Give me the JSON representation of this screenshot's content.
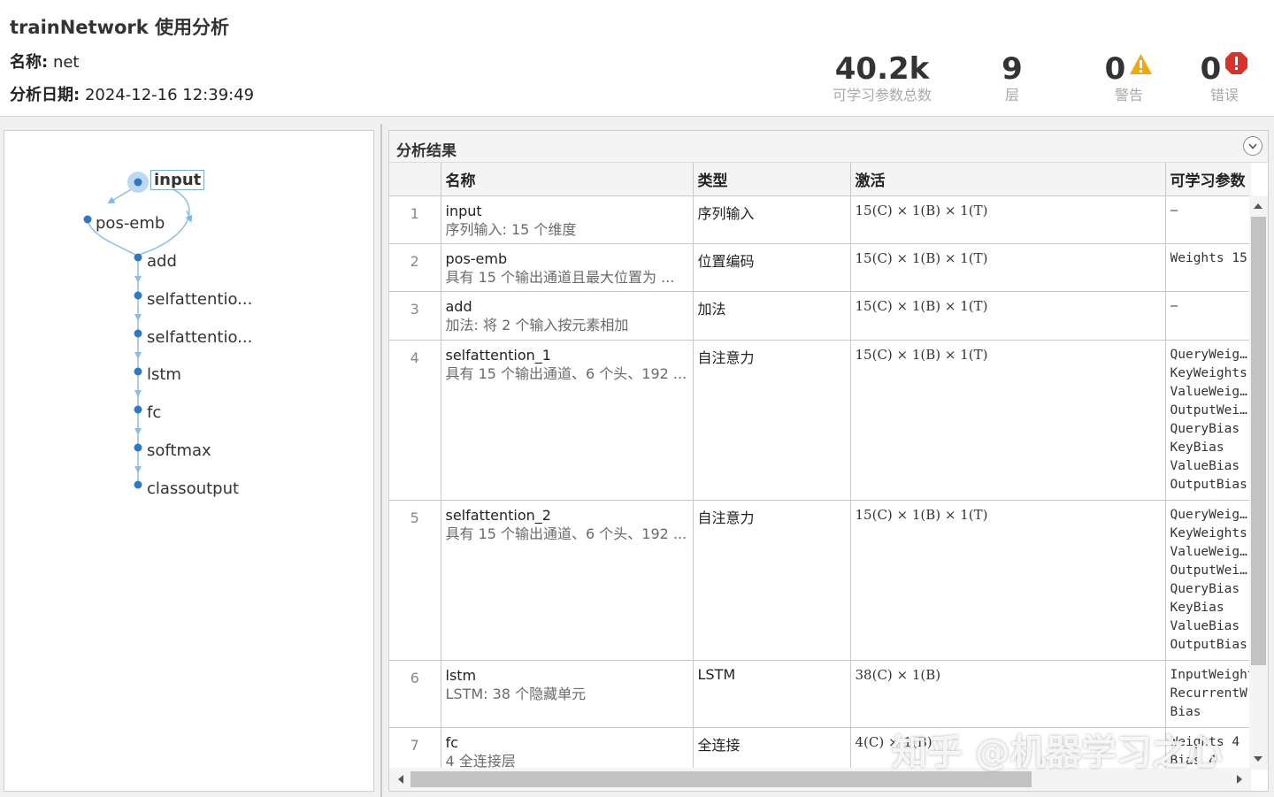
{
  "header": {
    "title": "trainNetwork 使用分析",
    "name_label": "名称:",
    "name_value": "net",
    "date_label": "分析日期:",
    "date_value": "2024-12-16 12:39:49"
  },
  "stats": {
    "params": {
      "value": "40.2k",
      "label": "可学习参数总数"
    },
    "layers": {
      "value": "9",
      "label": "层"
    },
    "warnings": {
      "value": "0",
      "label": "警告",
      "icon": "warning-icon",
      "color": "#f2a80c"
    },
    "errors": {
      "value": "0",
      "label": "错误",
      "icon": "error-icon",
      "color": "#d9322b"
    }
  },
  "graph": {
    "accent": "#2f78c4",
    "edge_color": "#8cbde6",
    "nodes": [
      "input",
      "pos-emb",
      "add",
      "selfattentio...",
      "selfattentio...",
      "lstm",
      "fc",
      "softmax",
      "classoutput"
    ],
    "selected": "input"
  },
  "results": {
    "title": "分析结果",
    "columns": [
      "名称",
      "类型",
      "激活",
      "可学习参数"
    ],
    "rows": [
      {
        "index": "1",
        "name": "input",
        "desc": "序列输入: 15 个维度",
        "type": "序列输入",
        "activation": "15(C) × 1(B) × 1(T)",
        "params": [
          "–"
        ]
      },
      {
        "index": "2",
        "name": "pos-emb",
        "desc": "具有 15 个输出通道且最大位置为 ...",
        "type": "位置编码",
        "activation": "15(C) × 1(B) × 1(T)",
        "params": [
          "Weights  15"
        ]
      },
      {
        "index": "3",
        "name": "add",
        "desc": "加法: 将 2 个输入按元素相加",
        "type": "加法",
        "activation": "15(C) × 1(B) × 1(T)",
        "params": [
          "–"
        ]
      },
      {
        "index": "4",
        "name": "selfattention_1",
        "desc": "具有 15 个输出通道、6 个头、192 ...",
        "type": "自注意力",
        "activation": "15(C) × 1(B) × 1(T)",
        "params": [
          "QueryWeig…",
          "KeyWeights",
          "ValueWeig…",
          "OutputWei…",
          "QueryBias",
          "KeyBias",
          "ValueBias",
          "OutputBias"
        ]
      },
      {
        "index": "5",
        "name": "selfattention_2",
        "desc": "具有 15 个输出通道、6 个头、192 ...",
        "type": "自注意力",
        "activation": "15(C) × 1(B) × 1(T)",
        "params": [
          "QueryWeig…",
          "KeyWeights",
          "ValueWeig…",
          "OutputWei…",
          "QueryBias",
          "KeyBias",
          "ValueBias",
          "OutputBias"
        ]
      },
      {
        "index": "6",
        "name": "lstm",
        "desc": "LSTM: 38 个隐藏单元",
        "type": "LSTM",
        "activation": "38(C) × 1(B)",
        "params": [
          "InputWeight",
          "RecurrentW",
          "Bias"
        ]
      },
      {
        "index": "7",
        "name": "fc",
        "desc": "4 全连接层",
        "type": "全连接",
        "activation": "4(C) × 1(B)",
        "params": [
          "Weights  4",
          "Bias     4"
        ]
      }
    ]
  },
  "watermark": "知乎 @机器学习之心"
}
